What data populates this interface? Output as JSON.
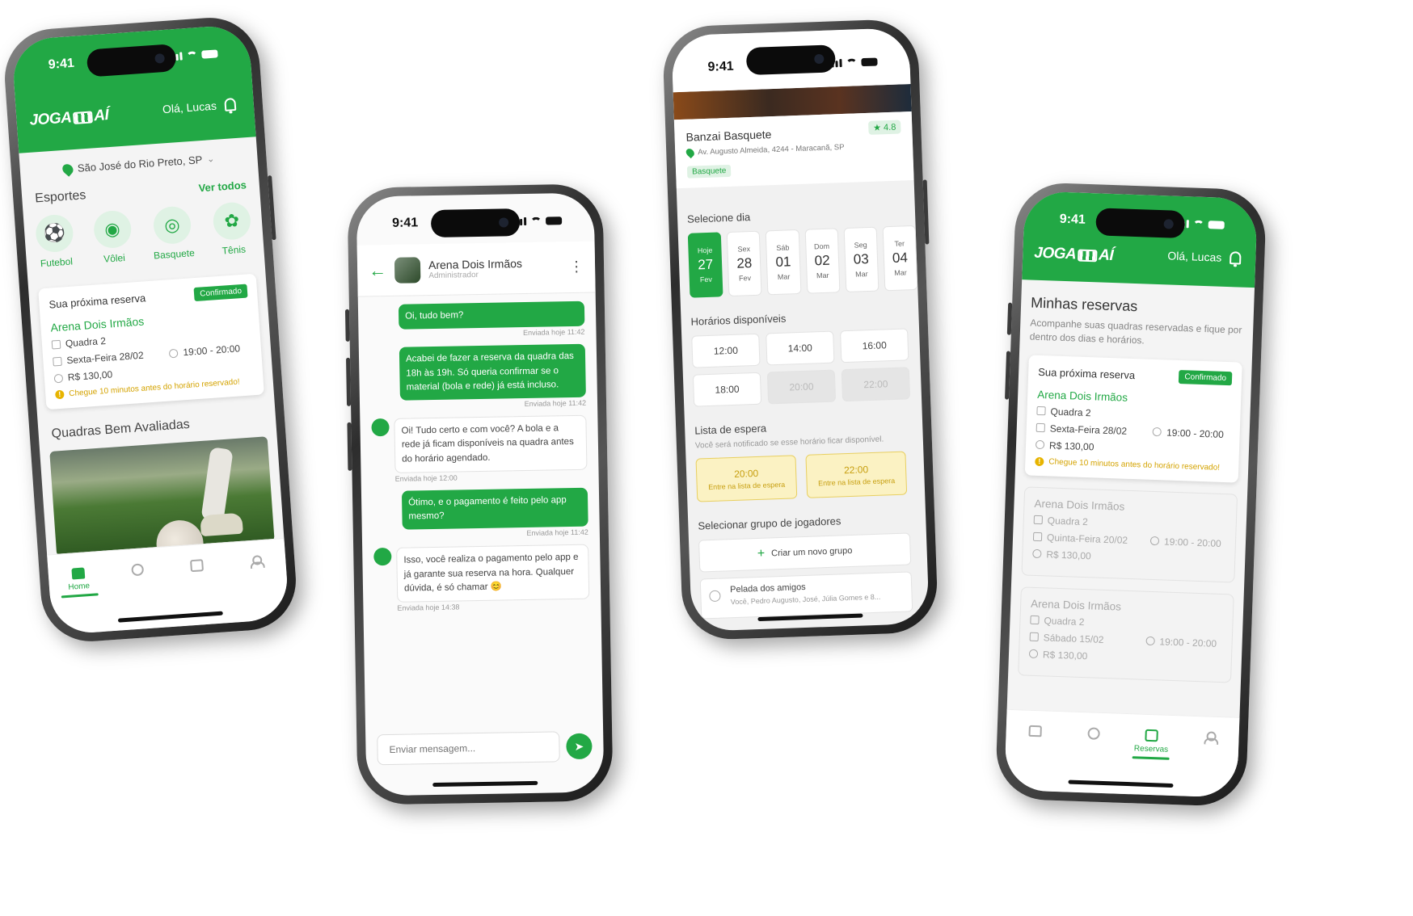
{
  "status": {
    "time": "9:41"
  },
  "brand": {
    "logo_left": "JOGA",
    "logo_right": "AÍ",
    "greeting": "Olá, Lucas"
  },
  "home": {
    "location": "São José do Rio Preto, SP",
    "sports_title": "Esportes",
    "see_all": "Ver todos",
    "sports": [
      {
        "label": "Futebol",
        "icon": "soccer-ball-icon"
      },
      {
        "label": "Vôlei",
        "icon": "volleyball-icon"
      },
      {
        "label": "Basquete",
        "icon": "basketball-icon"
      },
      {
        "label": "Tênis",
        "icon": "tennis-racket-icon"
      }
    ],
    "top_rated_title": "Quadras Bem Avaliadas"
  },
  "next_reservation": {
    "title": "Sua próxima reserva",
    "status": "Confirmado",
    "venue": "Arena Dois Irmãos",
    "court": "Quadra 2",
    "date": "Sexta-Feira 28/02",
    "hours": "19:00 - 20:00",
    "price": "R$ 130,00",
    "warning": "Chegue 10 minutos antes do horário reservado!"
  },
  "nav": {
    "home": "Home",
    "reservations": "Reservas"
  },
  "chat": {
    "title": "Arena Dois Irmãos",
    "subtitle": "Administrador",
    "messages": [
      {
        "dir": "out",
        "text": "Oi, tudo bem?",
        "time": "Enviada hoje 11:42"
      },
      {
        "dir": "out",
        "text": "Acabei de fazer a reserva da quadra das 18h às 19h. Só queria confirmar se o material (bola e rede) já está incluso.",
        "time": "Enviada hoje 11:42"
      },
      {
        "dir": "in",
        "text": "Oi! Tudo certo e com você? A bola e a rede já ficam disponíveis na quadra antes do horário agendado.",
        "time": "Enviada hoje 12:00"
      },
      {
        "dir": "out",
        "text": "Ótimo, e o pagamento é feito pelo app mesmo?",
        "time": "Enviada hoje 11:42"
      },
      {
        "dir": "in",
        "text": "Isso, você realiza o pagamento pelo app e já garante sua reserva na hora. Qualquer dúvida, é só chamar 😊",
        "time": "Enviada hoje 14:38"
      }
    ],
    "input_placeholder": "Enviar mensagem..."
  },
  "booking": {
    "venue": "Banzai Basquete",
    "rating": "4.8",
    "address": "Av. Augusto Almeida, 4244 - Maracanã, SP",
    "tag": "Basquete",
    "select_day": "Selecione dia",
    "days": [
      {
        "wd": "Hoje",
        "d": "27",
        "m": "Fev"
      },
      {
        "wd": "Sex",
        "d": "28",
        "m": "Fev"
      },
      {
        "wd": "Sáb",
        "d": "01",
        "m": "Mar"
      },
      {
        "wd": "Dom",
        "d": "02",
        "m": "Mar"
      },
      {
        "wd": "Seg",
        "d": "03",
        "m": "Mar"
      },
      {
        "wd": "Ter",
        "d": "04",
        "m": "Mar"
      }
    ],
    "slots_title": "Horários disponíveis",
    "slots": [
      "12:00",
      "14:00",
      "16:00",
      "18:00",
      "20:00",
      "22:00"
    ],
    "waitlist_title": "Lista de espera",
    "waitlist_note": "Você será notificado se esse horário ficar disponível.",
    "waitlist": [
      {
        "time": "20:00",
        "cta": "Entre na lista de espera"
      },
      {
        "time": "22:00",
        "cta": "Entre na lista de espera"
      }
    ],
    "group_title": "Selecionar grupo de jogadores",
    "new_group": "Criar um novo grupo",
    "group_name": "Pelada dos amigos",
    "group_members": "Você, Pedro Augusto, José, Júlia Gomes e 8..."
  },
  "reservations": {
    "title": "Minhas reservas",
    "desc": "Acompanhe suas quadras reservadas e fique por dentro dos dias e horários.",
    "past": [
      {
        "venue": "Arena Dois Irmãos",
        "court": "Quadra 2",
        "date": "Quinta-Feira 20/02",
        "hours": "19:00 - 20:00",
        "price": "R$ 130,00"
      },
      {
        "venue": "Arena Dois Irmãos",
        "court": "Quadra 2",
        "date": "Sábado 15/02",
        "hours": "19:00 - 20:00",
        "price": "R$ 130,00"
      }
    ]
  },
  "colors": {
    "brand_green": "#22a845",
    "warning_yellow": "#e7b400"
  }
}
